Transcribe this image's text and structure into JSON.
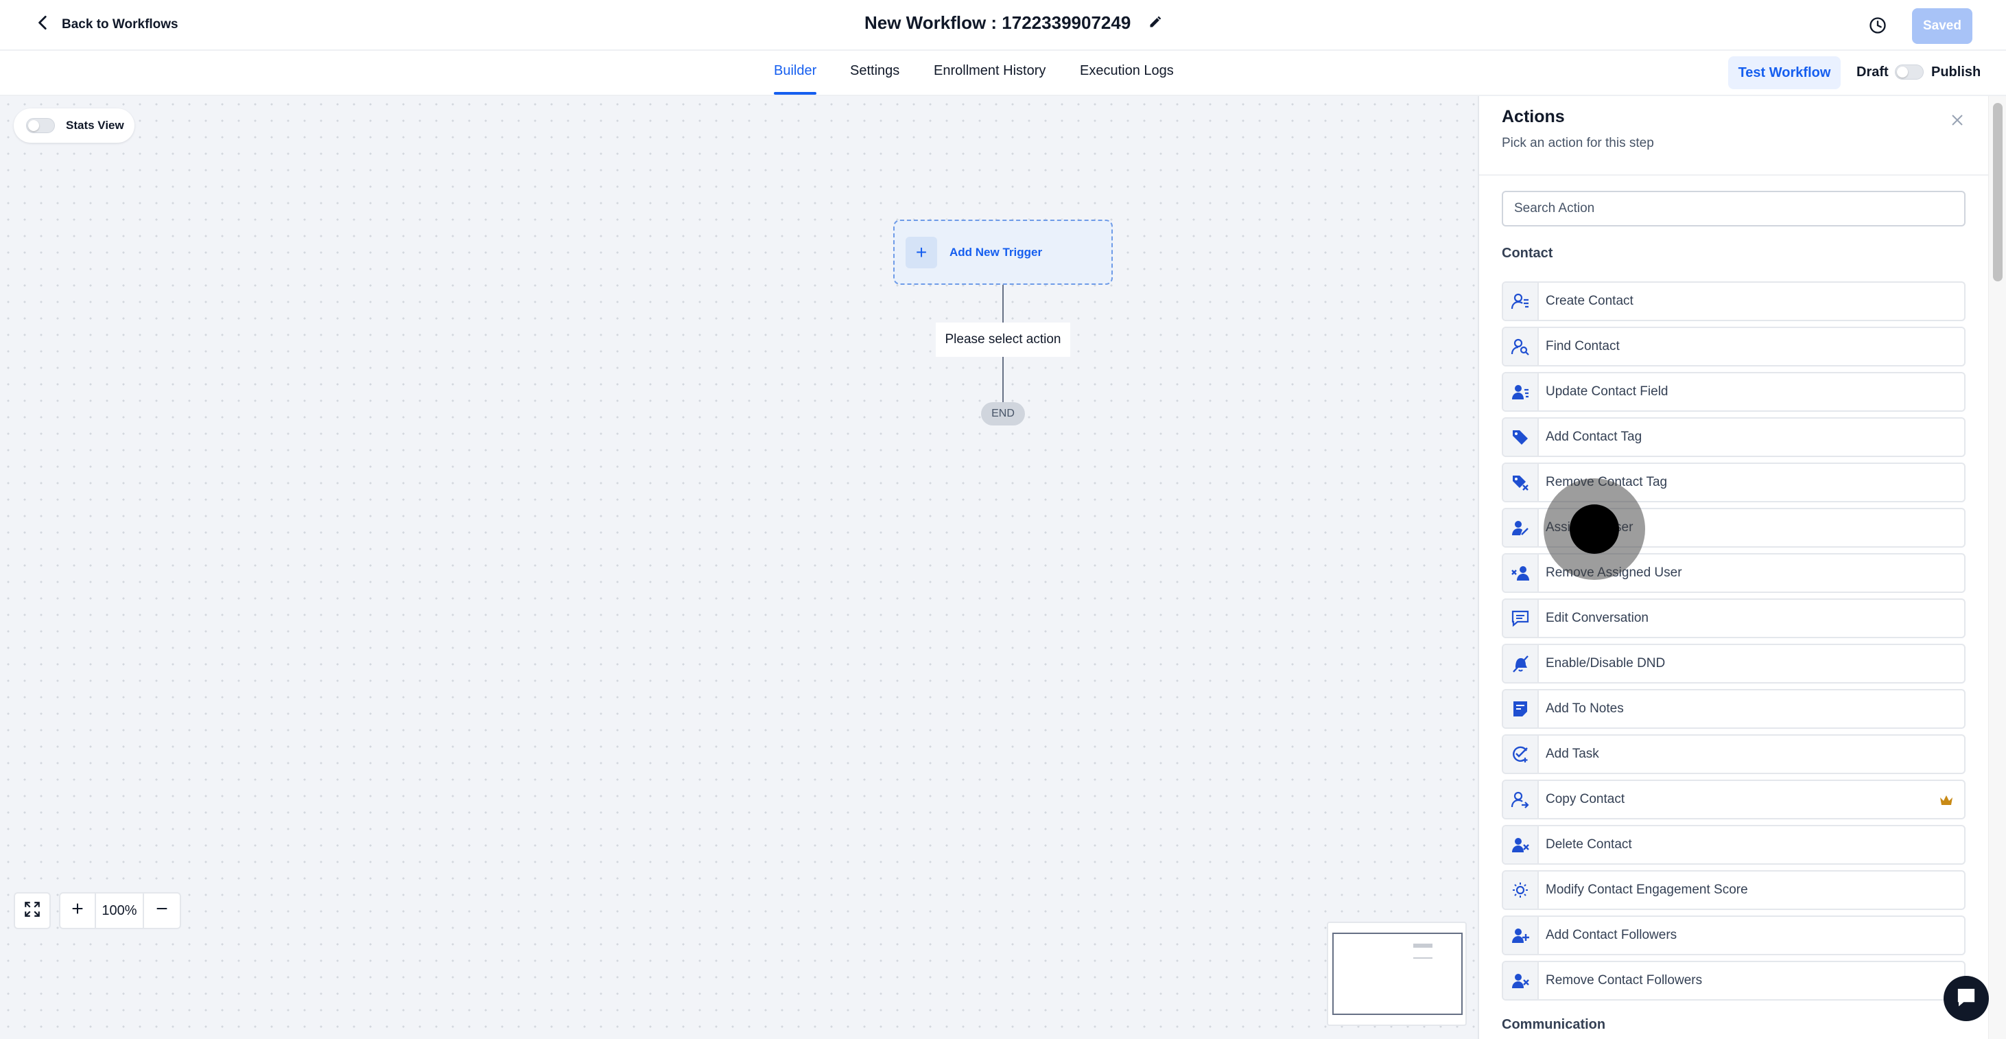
{
  "header": {
    "back_label": "Back to Workflows",
    "workflow_title": "New Workflow : 1722339907249",
    "saved_label": "Saved"
  },
  "subnav": {
    "tabs": [
      {
        "label": "Builder",
        "active": true
      },
      {
        "label": "Settings",
        "active": false
      },
      {
        "label": "Enrollment History",
        "active": false
      },
      {
        "label": "Execution Logs",
        "active": false
      }
    ],
    "test_label": "Test Workflow",
    "draft_label": "Draft",
    "publish_label": "Publish"
  },
  "canvas": {
    "stats_label": "Stats View",
    "trigger_label": "Add New Trigger",
    "select_action_label": "Please select action",
    "end_label": "END",
    "zoom_level": "100%"
  },
  "panel": {
    "title": "Actions",
    "subtitle": "Pick an action for this step",
    "search_placeholder": "Search Action",
    "sections": [
      {
        "heading": "Contact",
        "items": [
          {
            "label": "Create Contact",
            "icon": "create-contact-icon"
          },
          {
            "label": "Find Contact",
            "icon": "find-contact-icon"
          },
          {
            "label": "Update Contact Field",
            "icon": "update-contact-field-icon"
          },
          {
            "label": "Add Contact Tag",
            "icon": "tag-icon"
          },
          {
            "label": "Remove Contact Tag",
            "icon": "remove-tag-icon"
          },
          {
            "label": "Assign To User",
            "icon": "assign-user-icon"
          },
          {
            "label": "Remove Assigned User",
            "icon": "remove-user-icon"
          },
          {
            "label": "Edit Conversation",
            "icon": "conversation-icon"
          },
          {
            "label": "Enable/Disable DND",
            "icon": "dnd-bell-icon"
          },
          {
            "label": "Add To Notes",
            "icon": "notes-icon"
          },
          {
            "label": "Add Task",
            "icon": "task-check-icon"
          },
          {
            "label": "Copy Contact",
            "icon": "copy-contact-icon",
            "premium": true
          },
          {
            "label": "Delete Contact",
            "icon": "delete-contact-icon"
          },
          {
            "label": "Modify Contact Engagement Score",
            "icon": "engagement-score-icon"
          },
          {
            "label": "Add Contact Followers",
            "icon": "add-followers-icon"
          },
          {
            "label": "Remove Contact Followers",
            "icon": "remove-followers-icon"
          }
        ]
      },
      {
        "heading": "Communication",
        "items": []
      }
    ]
  },
  "colors": {
    "accent": "#155eef",
    "icon_blue": "#1f4fd1",
    "crown": "#c88a16"
  }
}
